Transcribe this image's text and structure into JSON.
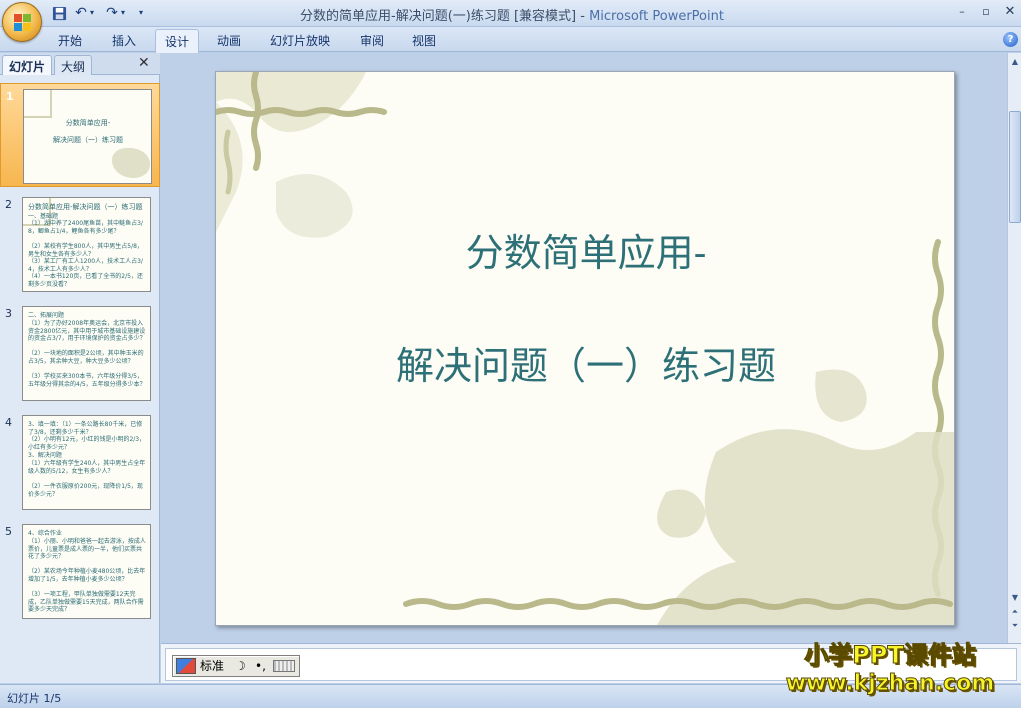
{
  "window": {
    "title": "分数的简单应用-解决问题(一)练习题 [兼容模式] - ",
    "app_name": "Microsoft PowerPoint",
    "controls": {
      "minimize": "–",
      "maximize": "▫",
      "close": "✕"
    }
  },
  "quick_access": {
    "undo": "↶",
    "redo": "↷",
    "dropdown": "▾",
    "customize": "▾"
  },
  "ribbon": {
    "tabs": [
      {
        "label": "开始",
        "active": false
      },
      {
        "label": "插入",
        "active": false
      },
      {
        "label": "设计",
        "active": true
      },
      {
        "label": "动画",
        "active": false
      },
      {
        "label": "幻灯片放映",
        "active": false
      },
      {
        "label": "审阅",
        "active": false
      },
      {
        "label": "视图",
        "active": false
      }
    ],
    "help": "?"
  },
  "pane": {
    "tabs": {
      "slides": "幻灯片",
      "outline": "大纲"
    },
    "close": "✕"
  },
  "thumbnails": [
    {
      "num": "1",
      "selected": true,
      "lines": [
        "分数简单应用-",
        "解决问题（一）练习题"
      ]
    },
    {
      "num": "2",
      "selected": false,
      "lines": [
        "分数简单应用-解决问题（一）练习题",
        "一、基础题",
        "（1）湖中养了2400尾鱼苗，其中鲢鱼占3/8，鲫鱼占1/4，鲤鱼各有多少尾？",
        "（2）某校有学生800人，其中男生占5/8，男生和女生各有多少人？",
        "（3）某工厂有工人1200人，技术工人占3/4，技术工人有多少人？",
        "（4）一本书120页，已看了全书的2/5，还剩多少页没看？"
      ]
    },
    {
      "num": "3",
      "selected": false,
      "lines": [
        "二、拓展问题",
        "（1）为了办好2008年奥运会，北京市投入资金2800亿元，其中用于城市基础设施建设的资金占3/7，用于环境保护的资金占多少？",
        "（2）一块地的面积是2公顷，其中种玉米的占3/5，其余种大豆，种大豆多少公顷？",
        "（3）学校买来300本书，六年级分得3/5，五年级分得其余的4/5，五年级分得多少本？"
      ]
    },
    {
      "num": "4",
      "selected": false,
      "lines": [
        "3、填一填：（1）一条公路长80千米，已修了3/8，还剩多少千米？",
        "（2）小明有12元，小红的钱是小明的2/3，小红有多少元？",
        "3、解决问题",
        "（1）六年级有学生240人，其中男生占全年级人数的5/12，女生有多少人？",
        "（2）一件衣服原价200元，现降价1/5，现价多少元？"
      ]
    },
    {
      "num": "5",
      "selected": false,
      "lines": [
        "4、综合作业",
        "（1）小丽、小明和爸爸一起去游泳，按成人票价，儿童票是成人票的一半，他们买票共花了多少元？",
        "（2）某农场今年种植小麦480公顷，比去年增加了1/5，去年种植小麦多少公顷？",
        "（3）一项工程，甲队单独做需要12天完成，乙队单独做需要15天完成，两队合作需要多少天完成？"
      ]
    }
  ],
  "slide": {
    "title_line1": "分数简单应用-",
    "title_line2": "解决问题（一）练习题"
  },
  "ime": {
    "mode": "标准",
    "moon": "☽",
    "punct": "•,",
    "keyboard": ""
  },
  "status": {
    "text": "幻灯片 1/5"
  },
  "watermark": {
    "line1": "小学PPT课件站",
    "line2": "www.kjzhan.com"
  },
  "colors": {
    "title_text": "#2d7077",
    "selection": "#f7b64f",
    "deco": "#b9b98c"
  }
}
